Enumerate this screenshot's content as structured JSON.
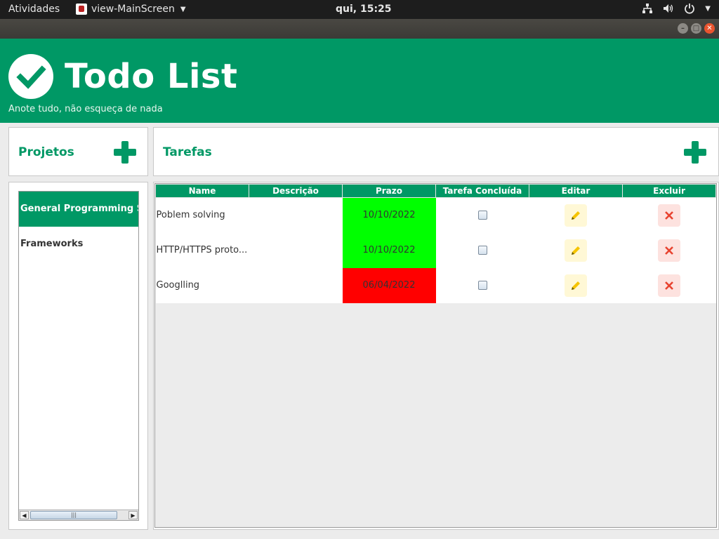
{
  "topbar": {
    "activities": "Atividades",
    "app_name": "view-MainScreen",
    "clock": "qui, 15:25",
    "tray_icons": [
      "network-icon",
      "volume-icon",
      "power-icon",
      "chevron-down-icon"
    ]
  },
  "window": {
    "buttons": [
      "minimize",
      "maximize",
      "close"
    ]
  },
  "header": {
    "title": "Todo List",
    "subtitle": "Anote tudo, não esqueça de nada",
    "accent": "#009865"
  },
  "projects": {
    "title": "Projetos",
    "items": [
      {
        "label": "General Programming Ski",
        "selected": true
      },
      {
        "label": "Frameworks",
        "selected": false
      }
    ]
  },
  "tasks": {
    "title": "Tarefas",
    "columns": [
      "Name",
      "Descrição",
      "Prazo",
      "Tarefa Concluída",
      "Editar",
      "Excluir"
    ],
    "rows": [
      {
        "name": "Poblem solving",
        "description": "",
        "deadline": "10/10/2022",
        "deadline_status": "ok",
        "done": false
      },
      {
        "name": "HTTP/HTTPS proto...",
        "description": "",
        "deadline": "10/10/2022",
        "deadline_status": "ok",
        "done": false
      },
      {
        "name": "Googlling",
        "description": "",
        "deadline": "06/04/2022",
        "deadline_status": "late",
        "done": false
      }
    ],
    "status_colors": {
      "ok": "#00ff00",
      "late": "#ff0000"
    }
  }
}
